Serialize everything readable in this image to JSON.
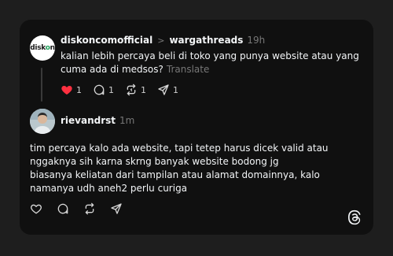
{
  "post": {
    "author": "diskoncomofficial",
    "separator": ">",
    "reply_to": "wargathreads",
    "time": "19h",
    "text": "kalian lebih percaya beli di toko yang punya website atau yang cuma ada di medsos?",
    "translate_label": "Translate",
    "likes": "1",
    "replies": "1",
    "reposts": "1",
    "shares": "1",
    "liked": true,
    "accent_like_color": "#ff3040"
  },
  "reply": {
    "author": "rievandrst",
    "time": "1m",
    "lines": [
      "tim percaya kalo ada website, tapi tetep harus dicek valid atau nggaknya sih karna skrng banyak website bodong jg",
      "biasanya keliatan dari tampilan atau alamat domainnya, kalo namanya udh aneh2 perlu curiga"
    ]
  },
  "avatar_logo": {
    "text_a": "disk",
    "text_b": "o",
    "text_c": "n"
  },
  "icons": {
    "like": "heart-icon",
    "reply": "comment-icon",
    "repost": "repost-icon",
    "share": "send-icon",
    "app": "threads-logo-icon"
  }
}
